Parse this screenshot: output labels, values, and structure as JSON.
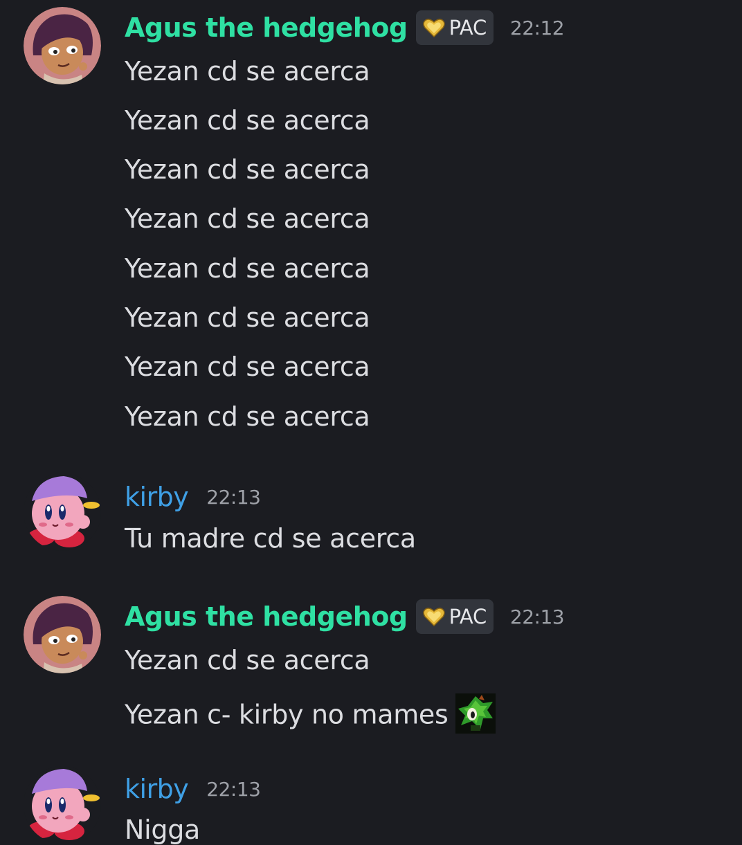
{
  "messages": [
    {
      "user": "Agus the hedgehog",
      "role_tag": "PAC",
      "role_tag_icon": "gold-heart-icon",
      "time": "22:12",
      "lines": [
        "Yezan cd se acerca",
        "Yezan cd se acerca",
        "Yezan cd se acerca",
        "Yezan cd se acerca",
        "Yezan cd se acerca",
        "Yezan cd se acerca",
        "Yezan cd se acerca",
        "Yezan cd se acerca"
      ]
    },
    {
      "user": "kirby",
      "time": "22:13",
      "lines": [
        "Tu madre cd se acerca"
      ]
    },
    {
      "user": "Agus the hedgehog",
      "role_tag": "PAC",
      "role_tag_icon": "gold-heart-icon",
      "time": "22:13",
      "lines": [
        "Yezan cd se acerca",
        "Yezan c- kirby no mames"
      ],
      "custom_emoji": "green-hedgehog-emoji"
    },
    {
      "user": "kirby",
      "time": "22:13",
      "lines": [
        "Nigga"
      ]
    }
  ],
  "colors": {
    "background": "#1b1c21",
    "agus_name": "#2fe0a3",
    "kirby_name": "#3fa0e6",
    "message_text": "#dcdde1",
    "timestamp": "#9ea1a8",
    "tag_bg": "#32353c"
  }
}
